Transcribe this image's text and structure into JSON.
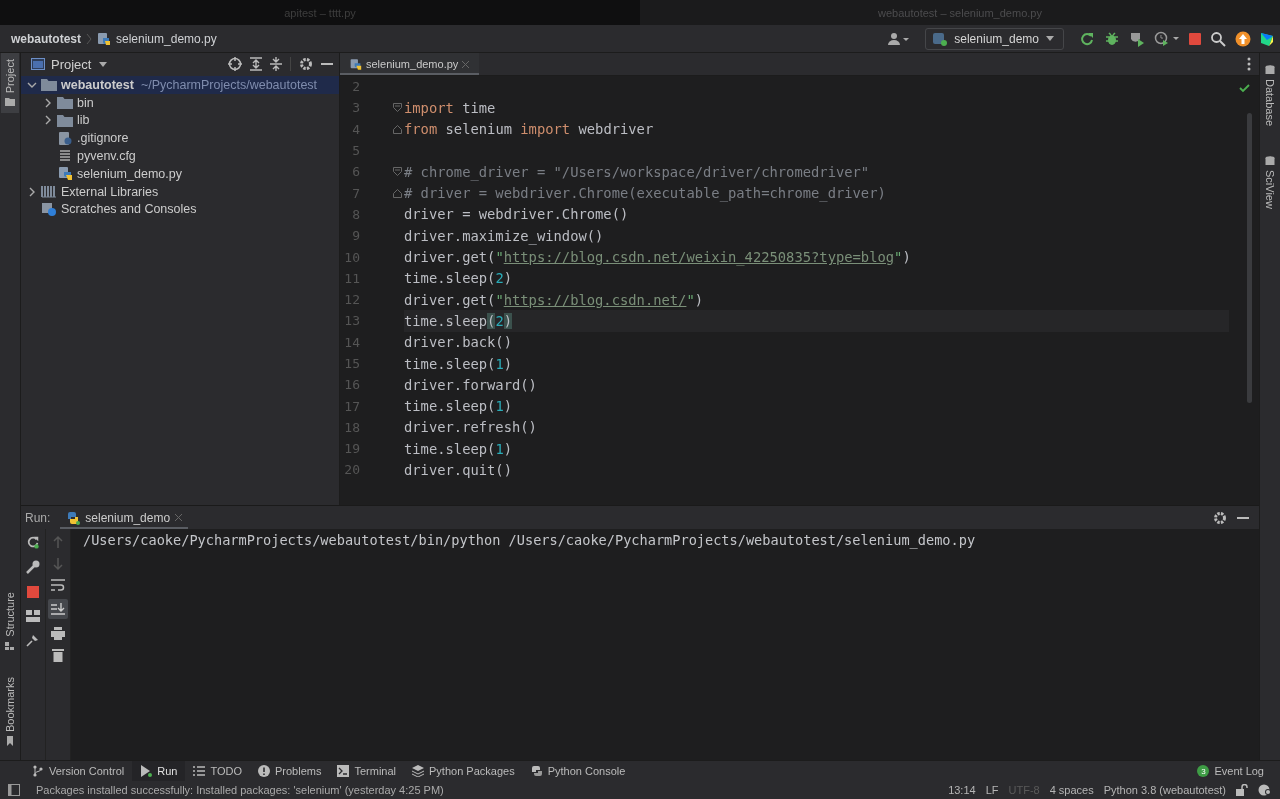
{
  "title_bar": {
    "tabs": [
      {
        "label": "apitest – tttt.py",
        "selected": false
      },
      {
        "label": "webautotest – selenium_demo.py",
        "selected": true
      }
    ]
  },
  "nav_bar": {
    "breadcrumbs": [
      {
        "label": "webautotest",
        "kind": "project"
      },
      {
        "label": "selenium_demo.py",
        "kind": "python"
      }
    ],
    "run_config": "selenium_demo"
  },
  "left_stripe": [
    {
      "label": "Project",
      "selected": true,
      "kind": "project"
    },
    {
      "label": "Structure",
      "selected": false,
      "kind": "structure"
    },
    {
      "label": "Bookmarks",
      "selected": false,
      "kind": "bookmarks"
    }
  ],
  "right_stripe": [
    {
      "label": "Database"
    },
    {
      "label": "SciView"
    }
  ],
  "project_panel": {
    "title": "Project",
    "tree": [
      {
        "label": "webautotest",
        "note": "~/PycharmProjects/webautotest",
        "kind": "project",
        "expanded": true,
        "selected": true,
        "children": [
          {
            "label": "bin",
            "kind": "folder",
            "expanded": false,
            "selected": false
          },
          {
            "label": "lib",
            "kind": "folder",
            "expanded": false,
            "selected": false
          },
          {
            "label": ".gitignore",
            "kind": "ignore",
            "selected": false
          },
          {
            "label": "pyvenv.cfg",
            "kind": "config",
            "selected": false
          },
          {
            "label": "selenium_demo.py",
            "kind": "python",
            "selected": false
          }
        ]
      },
      {
        "label": "External Libraries",
        "kind": "library",
        "expanded": false,
        "selected": false
      },
      {
        "label": "Scratches and Consoles",
        "kind": "scratches",
        "selected": false
      }
    ]
  },
  "editor": {
    "tabs": [
      {
        "label": "selenium_demo.py",
        "selected": true
      }
    ],
    "lines": [
      {
        "number": "2"
      },
      {
        "number": "3",
        "fold_start": true,
        "tokens": [
          {
            "kind": "kw",
            "text": "import"
          },
          {
            "kind": "plain",
            "text": " time"
          }
        ]
      },
      {
        "number": "4",
        "fold_end": true,
        "tokens": [
          {
            "kind": "kw",
            "text": "from"
          },
          {
            "kind": "plain",
            "text": " selenium "
          },
          {
            "kind": "kw",
            "text": "import"
          },
          {
            "kind": "plain",
            "text": " webdriver"
          }
        ]
      },
      {
        "number": "5"
      },
      {
        "number": "6",
        "fold_start": true,
        "tokens": [
          {
            "kind": "comment",
            "text": "# chrome_driver = \"/Users/workspace/driver/chromedriver\""
          }
        ]
      },
      {
        "number": "7",
        "fold_end": true,
        "tokens": [
          {
            "kind": "comment",
            "text": "# driver = webdriver.Chrome(executable_path=chrome_driver)"
          }
        ]
      },
      {
        "number": "8",
        "tokens": [
          {
            "kind": "plain",
            "text": "driver = webdriver.Chrome()"
          }
        ]
      },
      {
        "number": "9",
        "tokens": [
          {
            "kind": "plain",
            "text": "driver.maximize_window()"
          }
        ]
      },
      {
        "number": "10",
        "tokens": [
          {
            "kind": "plain",
            "text": "driver.get("
          },
          {
            "kind": "str",
            "text": "\""
          },
          {
            "kind": "url",
            "text": "https://blog.csdn.net/weixin_42250835?type=blog"
          },
          {
            "kind": "str",
            "text": "\""
          },
          {
            "kind": "plain",
            "text": ")"
          }
        ]
      },
      {
        "number": "11",
        "tokens": [
          {
            "kind": "plain",
            "text": "time.sleep("
          },
          {
            "kind": "num",
            "text": "2"
          },
          {
            "kind": "plain",
            "text": ")"
          }
        ]
      },
      {
        "number": "12",
        "tokens": [
          {
            "kind": "plain",
            "text": "driver.get("
          },
          {
            "kind": "str",
            "text": "\""
          },
          {
            "kind": "url",
            "text": "https://blog.csdn.net/"
          },
          {
            "kind": "str",
            "text": "\""
          },
          {
            "kind": "plain",
            "text": ")"
          }
        ]
      },
      {
        "number": "13",
        "current": true,
        "tokens": [
          {
            "kind": "plain",
            "text": "time.sleep"
          },
          {
            "kind": "match",
            "text": "("
          },
          {
            "kind": "num",
            "text": "2"
          },
          {
            "kind": "match",
            "text": ")"
          }
        ]
      },
      {
        "number": "14",
        "tokens": [
          {
            "kind": "plain",
            "text": "driver.back()"
          }
        ]
      },
      {
        "number": "15",
        "tokens": [
          {
            "kind": "plain",
            "text": "time.sleep("
          },
          {
            "kind": "num",
            "text": "1"
          },
          {
            "kind": "plain",
            "text": ")"
          }
        ]
      },
      {
        "number": "16",
        "tokens": [
          {
            "kind": "plain",
            "text": "driver.forward()"
          }
        ]
      },
      {
        "number": "17",
        "tokens": [
          {
            "kind": "plain",
            "text": "time.sleep("
          },
          {
            "kind": "num",
            "text": "1"
          },
          {
            "kind": "plain",
            "text": ")"
          }
        ]
      },
      {
        "number": "18",
        "tokens": [
          {
            "kind": "plain",
            "text": "driver.refresh()"
          }
        ]
      },
      {
        "number": "19",
        "tokens": [
          {
            "kind": "plain",
            "text": "time.sleep("
          },
          {
            "kind": "num",
            "text": "1"
          },
          {
            "kind": "plain",
            "text": ")"
          }
        ]
      },
      {
        "number": "20",
        "tokens": [
          {
            "kind": "plain",
            "text": "driver.quit()"
          }
        ]
      }
    ]
  },
  "run_panel": {
    "label": "Run:",
    "tabs": [
      {
        "label": "selenium_demo",
        "selected": true
      }
    ],
    "output": "/Users/caoke/PycharmProjects/webautotest/bin/python /Users/caoke/PycharmProjects/webautotest/selenium_demo.py"
  },
  "tool_windows": [
    {
      "label": "Version Control",
      "kind": "vcs",
      "selected": false
    },
    {
      "label": "Run",
      "kind": "run",
      "selected": true
    },
    {
      "label": "TODO",
      "kind": "todo",
      "selected": false
    },
    {
      "label": "Problems",
      "kind": "problems",
      "selected": false
    },
    {
      "label": "Terminal",
      "kind": "terminal",
      "selected": false
    },
    {
      "label": "Python Packages",
      "kind": "packages",
      "selected": false
    },
    {
      "label": "Python Console",
      "kind": "console",
      "selected": false
    }
  ],
  "event_log": {
    "label": "Event Log",
    "badge": "3"
  },
  "status_bar": {
    "message": "Packages installed successfully: Installed packages: 'selenium' (yesterday 4:25 PM)",
    "items": [
      {
        "label": "13:14",
        "disabled": false
      },
      {
        "label": "LF",
        "disabled": false
      },
      {
        "label": "UTF-8",
        "disabled": true
      },
      {
        "label": "4 spaces",
        "disabled": false
      },
      {
        "label": "Python 3.8 (webautotest)",
        "disabled": false
      }
    ]
  }
}
